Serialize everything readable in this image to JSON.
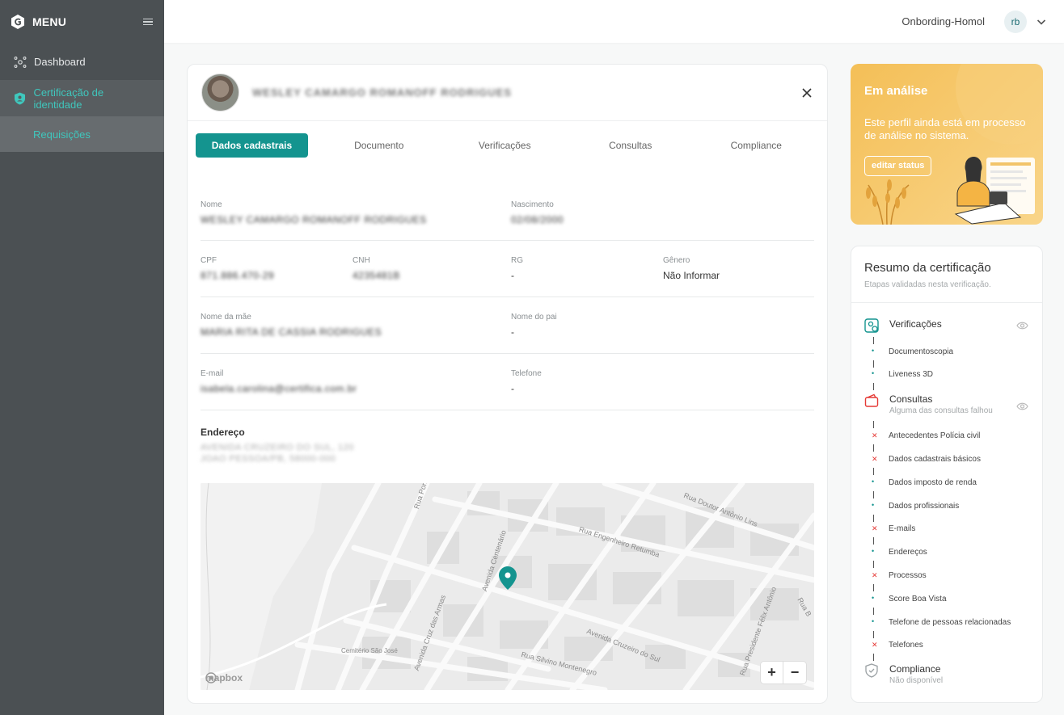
{
  "sidebar": {
    "menu_label": "MENU",
    "items": [
      {
        "label": "Dashboard"
      },
      {
        "label": "Certificação de identidade"
      }
    ],
    "sub_items": [
      {
        "label": "Requisições"
      }
    ]
  },
  "topbar": {
    "org": "Onbording-Homol",
    "avatar": "rb"
  },
  "profile": {
    "name": "WESLEY CAMARGO ROMANOFF RODRIGUES"
  },
  "tabs": [
    "Dados cadastrais",
    "Documento",
    "Verificações",
    "Consultas",
    "Compliance"
  ],
  "fields": {
    "nome": {
      "label": "Nome",
      "value": "WESLEY CAMARGO ROMANOFF RODRIGUES"
    },
    "nascimento": {
      "label": "Nascimento",
      "value": "02/08/2000"
    },
    "cpf": {
      "label": "CPF",
      "value": "871.886.470-29"
    },
    "cnh": {
      "label": "CNH",
      "value": "4235481B"
    },
    "rg": {
      "label": "RG",
      "value": "-"
    },
    "genero": {
      "label": "Gênero",
      "value": "Não Informar"
    },
    "mae": {
      "label": "Nome da mãe",
      "value": "MARIA RITA DE CASSIA RODRIGUES"
    },
    "pai": {
      "label": "Nome do pai",
      "value": "-"
    },
    "email": {
      "label": "E-mail",
      "value": "isabela.carolina@certifica.com.br"
    },
    "telefone": {
      "label": "Telefone",
      "value": "-"
    }
  },
  "address": {
    "label": "Endereço",
    "line1": "AVENIDA CRUZEIRO DO SUL, 120",
    "line2": "JOAO PESSOA/PB, 58000-000"
  },
  "map": {
    "streets": [
      "Rua Porfírio Co",
      "Rua Doutor Antônio Lins",
      "Rua Engenheiro Retumba",
      "Avenida Centenário",
      "Avenida Cruz das Armas",
      "Avenida Cruzeiro do Sul",
      "Rua Presidente Félix Antônio",
      "Rua Silvino Montenegro",
      "Cemitério São José",
      "Rua B"
    ],
    "attribution": "mapbox",
    "zoom_in": "+",
    "zoom_out": "−"
  },
  "status": {
    "title": "Em análise",
    "text": "Este perfil ainda está em processo de análise no sistema.",
    "button": "editar status",
    "color": "#f4bf57"
  },
  "summary": {
    "title": "Resumo da certificação",
    "subtitle": "Etapas validadas nesta verificação.",
    "groups": [
      {
        "title": "Verificações",
        "subtitle": "",
        "items": [
          {
            "label": "Documentoscopia",
            "status": "ok"
          },
          {
            "label": "Liveness 3D",
            "status": "ok"
          }
        ]
      },
      {
        "title": "Consultas",
        "subtitle": "Alguma das consultas falhou",
        "items": [
          {
            "label": "Antecedentes Polícia civil",
            "status": "fail"
          },
          {
            "label": "Dados cadastrais básicos",
            "status": "fail"
          },
          {
            "label": "Dados imposto de renda",
            "status": "ok"
          },
          {
            "label": "Dados profissionais",
            "status": "ok"
          },
          {
            "label": "E-mails",
            "status": "fail"
          },
          {
            "label": "Endereços",
            "status": "ok"
          },
          {
            "label": "Processos",
            "status": "fail"
          },
          {
            "label": "Score Boa Vista",
            "status": "ok"
          },
          {
            "label": "Telefone de pessoas relacionadas",
            "status": "ok"
          },
          {
            "label": "Telefones",
            "status": "fail"
          }
        ]
      },
      {
        "title": "Compliance",
        "subtitle": "Não disponível",
        "items": []
      }
    ],
    "ok_color": "#14948f",
    "fail_color": "#e53935"
  }
}
